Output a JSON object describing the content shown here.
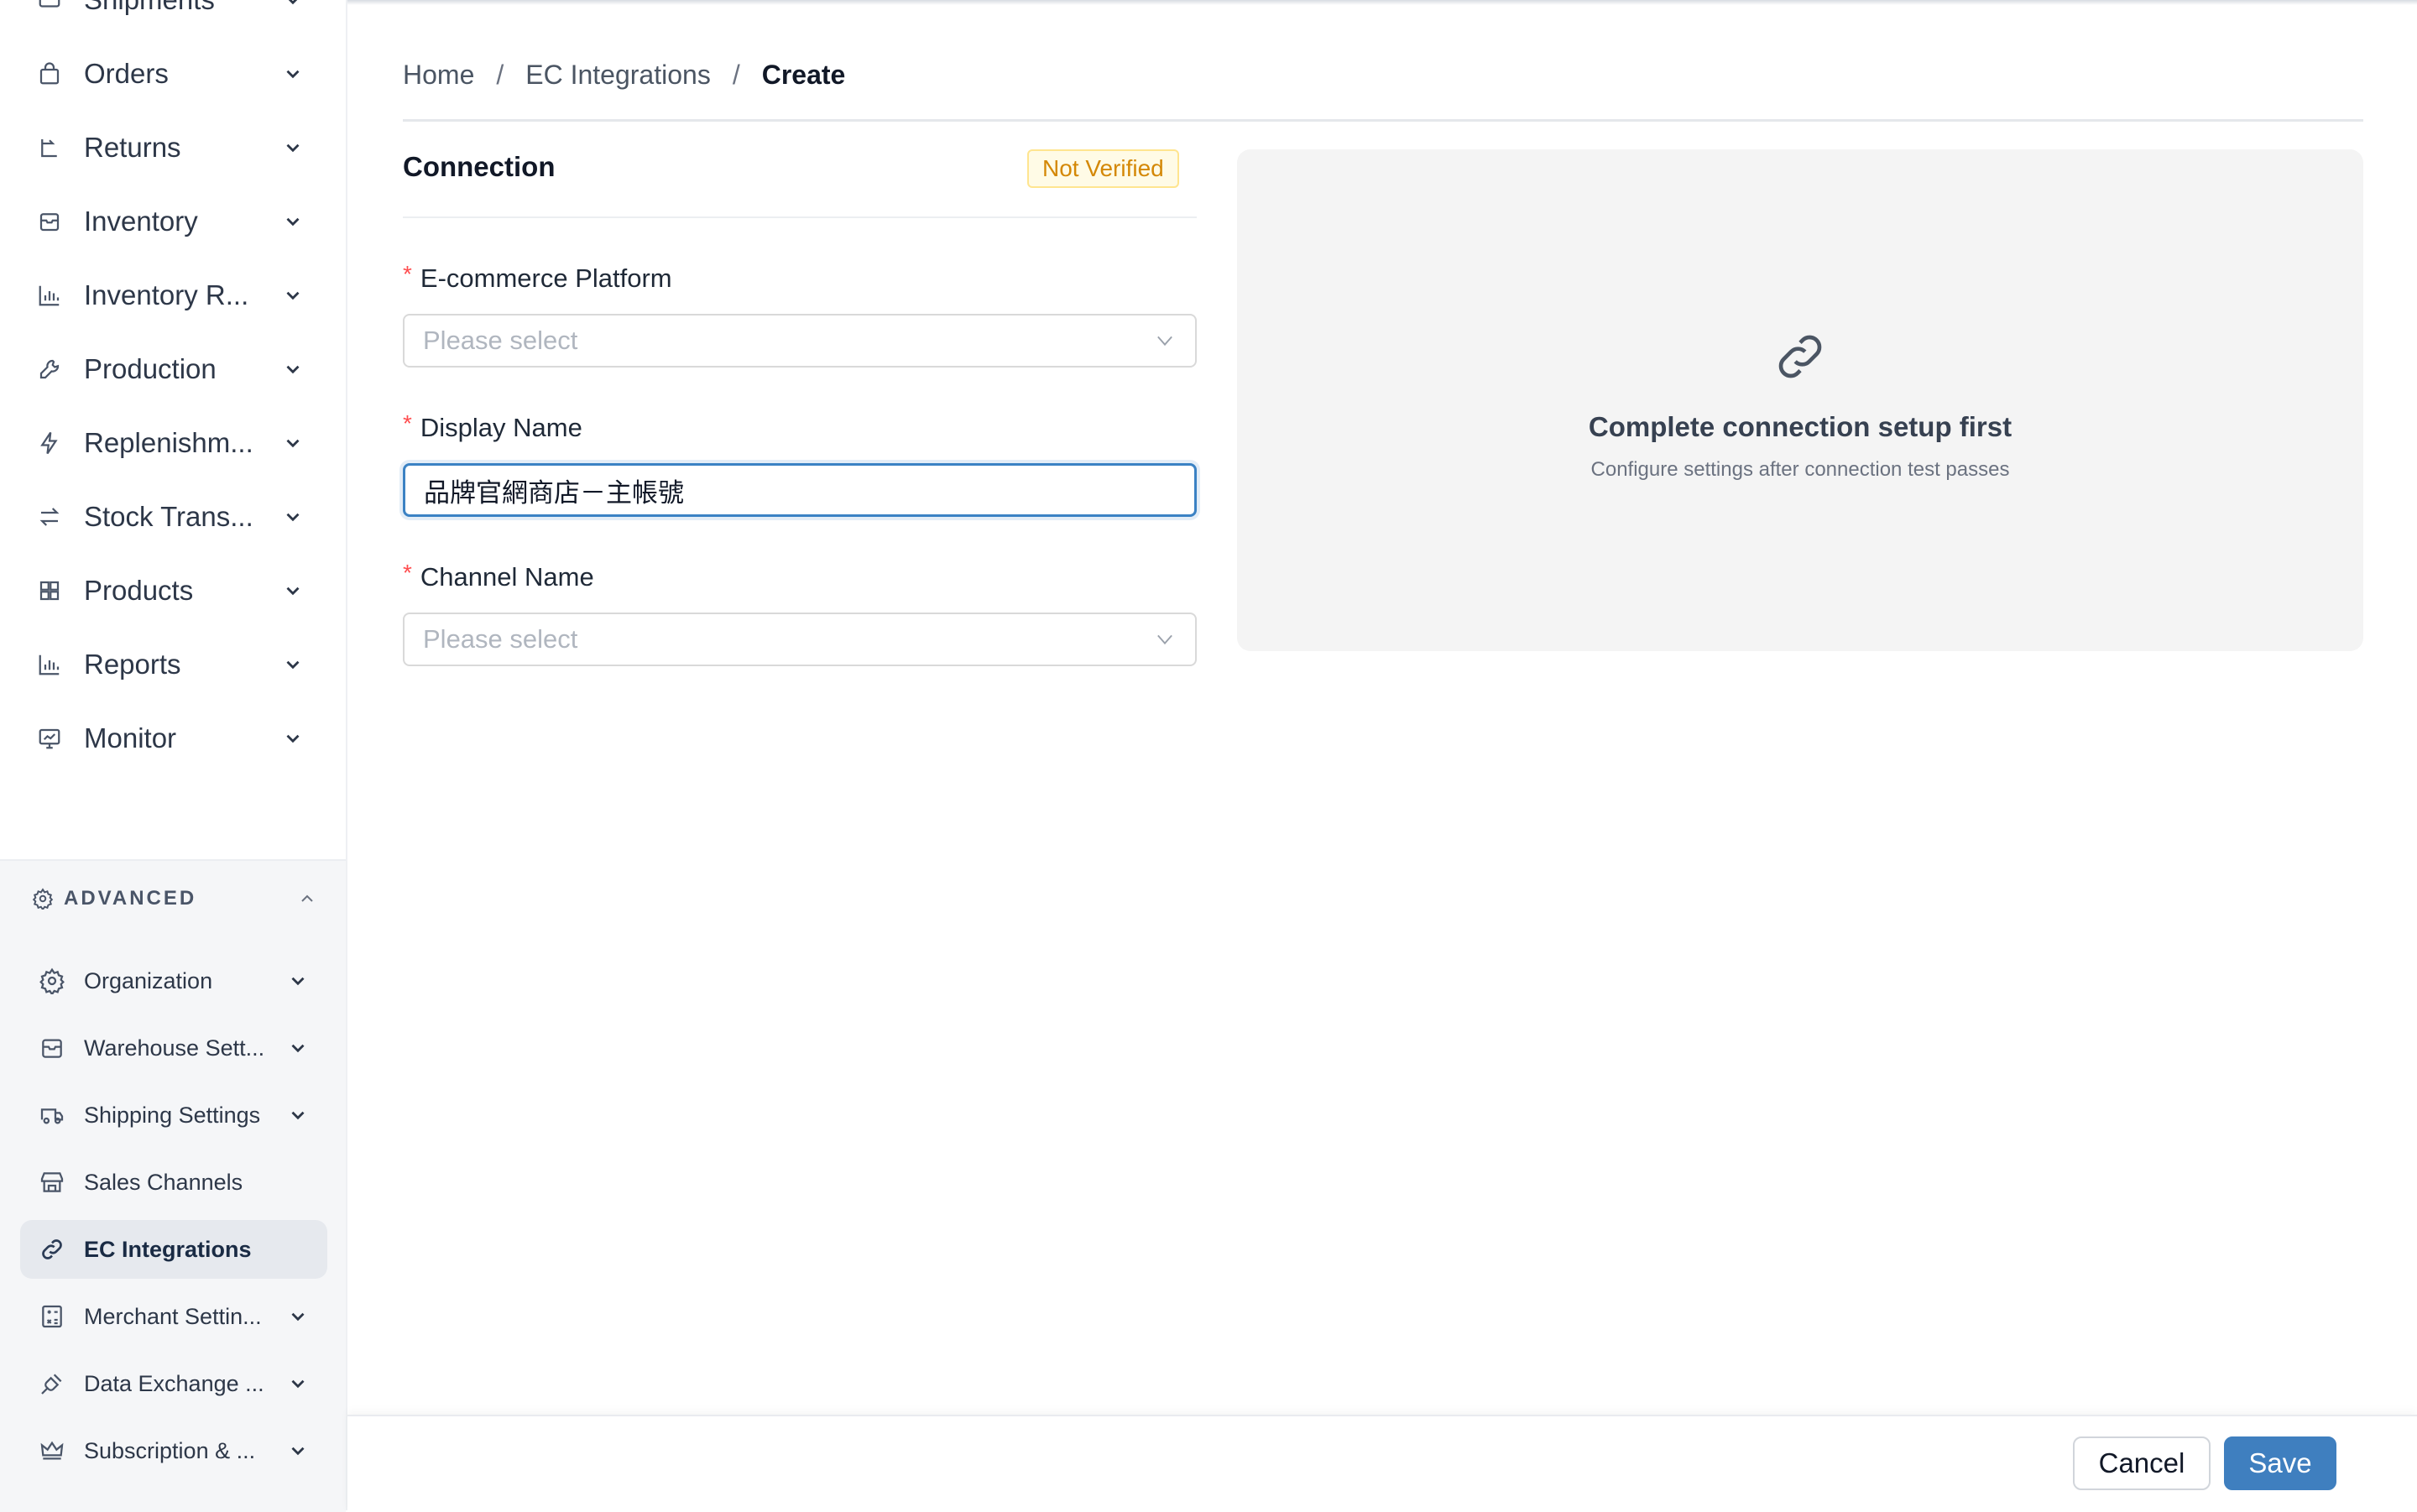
{
  "sidebar": {
    "partial_top": {
      "label": "Shipments",
      "icon": "truck-icon"
    },
    "items": [
      {
        "label": "Orders",
        "icon": "bag-icon"
      },
      {
        "label": "Returns",
        "icon": "return-icon"
      },
      {
        "label": "Inventory",
        "icon": "box-icon"
      },
      {
        "label": "Inventory R...",
        "icon": "bar-chart-icon"
      },
      {
        "label": "Production",
        "icon": "wrench-icon"
      },
      {
        "label": "Replenishm...",
        "icon": "lightning-icon"
      },
      {
        "label": "Stock Trans...",
        "icon": "transfer-icon"
      },
      {
        "label": "Products",
        "icon": "grid-icon"
      },
      {
        "label": "Reports",
        "icon": "bar-chart-icon"
      },
      {
        "label": "Monitor",
        "icon": "monitor-icon"
      }
    ],
    "advanced": {
      "label": "ADVANCED",
      "items": [
        {
          "label": "Organization",
          "icon": "gear-icon",
          "has_children": true
        },
        {
          "label": "Warehouse Sett...",
          "icon": "warehouse-icon",
          "has_children": true
        },
        {
          "label": "Shipping Settings",
          "icon": "truck-icon",
          "has_children": true
        },
        {
          "label": "Sales Channels",
          "icon": "store-icon",
          "has_children": false
        },
        {
          "label": "EC Integrations",
          "icon": "link-icon",
          "has_children": false,
          "active": true
        },
        {
          "label": "Merchant Settin...",
          "icon": "calculator-icon",
          "has_children": true
        },
        {
          "label": "Data Exchange ...",
          "icon": "plug-icon",
          "has_children": true
        },
        {
          "label": "Subscription & ...",
          "icon": "crown-icon",
          "has_children": true
        }
      ]
    }
  },
  "breadcrumb": {
    "home": "Home",
    "parent": "EC Integrations",
    "current": "Create",
    "separator": "/"
  },
  "connection": {
    "title": "Connection",
    "status_badge": "Not Verified",
    "fields": {
      "platform": {
        "label": "E-commerce Platform",
        "placeholder": "Please select",
        "required": true
      },
      "display_name": {
        "label": "Display Name",
        "value": "品牌官網商店－主帳號",
        "required": true
      },
      "channel_name": {
        "label": "Channel Name",
        "placeholder": "Please select",
        "required": true
      }
    },
    "required_marker": "*"
  },
  "placeholder_panel": {
    "icon": "link-icon",
    "icon_glyph": "🔗",
    "title": "Complete connection setup first",
    "subtitle": "Configure settings after connection test passes"
  },
  "footer": {
    "cancel_label": "Cancel",
    "save_label": "Save"
  },
  "colors": {
    "accent": "#3f7fbf",
    "badge_text": "#d48806",
    "badge_bg": "#fffbe6",
    "required": "#ff4d4f",
    "active_nav_bg": "#e6e9ee"
  }
}
